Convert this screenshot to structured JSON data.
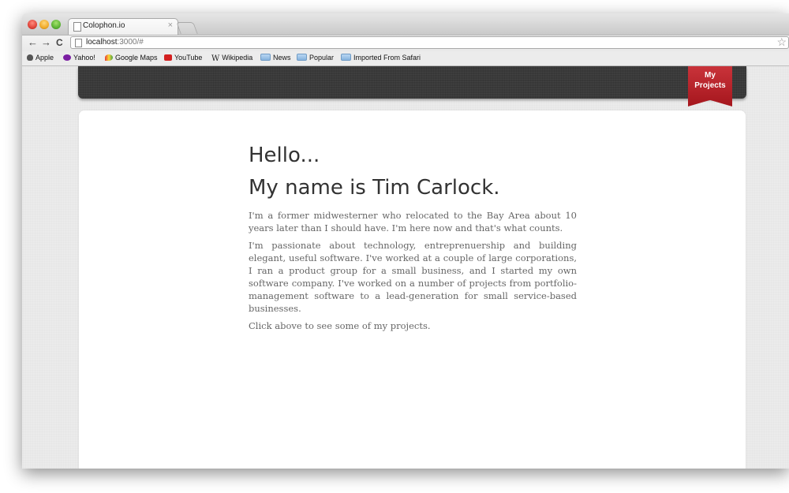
{
  "browser": {
    "tab_title": "Colophon.io",
    "tab_close": "×",
    "back": "←",
    "forward": "→",
    "reload": "C",
    "url_host": "localhost",
    "url_path": ":3000/#",
    "star": "☆",
    "bookmarks": [
      {
        "label": "Apple",
        "icon": "apple-icon"
      },
      {
        "label": "Yahoo!",
        "icon": "yahoo-icon"
      },
      {
        "label": "Google Maps",
        "icon": "google-maps-icon"
      },
      {
        "label": "YouTube",
        "icon": "youtube-icon"
      },
      {
        "label": "Wikipedia",
        "icon": "wikipedia-icon"
      },
      {
        "label": "News",
        "icon": "folder-icon"
      },
      {
        "label": "Popular",
        "icon": "folder-icon"
      },
      {
        "label": "Imported From Safari",
        "icon": "folder-icon"
      }
    ]
  },
  "page": {
    "nav": {
      "projects_label": "My Projects",
      "ribbon_color": "#b3222a"
    },
    "heading_1": "Hello...",
    "heading_2": "My name is Tim Carlock.",
    "paragraphs": [
      "I'm a former midwesterner who relocated to the Bay Area about 10 years later than I should have. I'm here now and that's what counts.",
      "I'm passionate about technology, entreprenuership and building elegant, useful software. I've worked at a couple of large corporations, I ran a product group for a small business, and I started my own software company. I've worked on a number of projects from portfolio-management software to a lead-generation for small service-based businesses.",
      "Click above to see some of my projects."
    ]
  }
}
